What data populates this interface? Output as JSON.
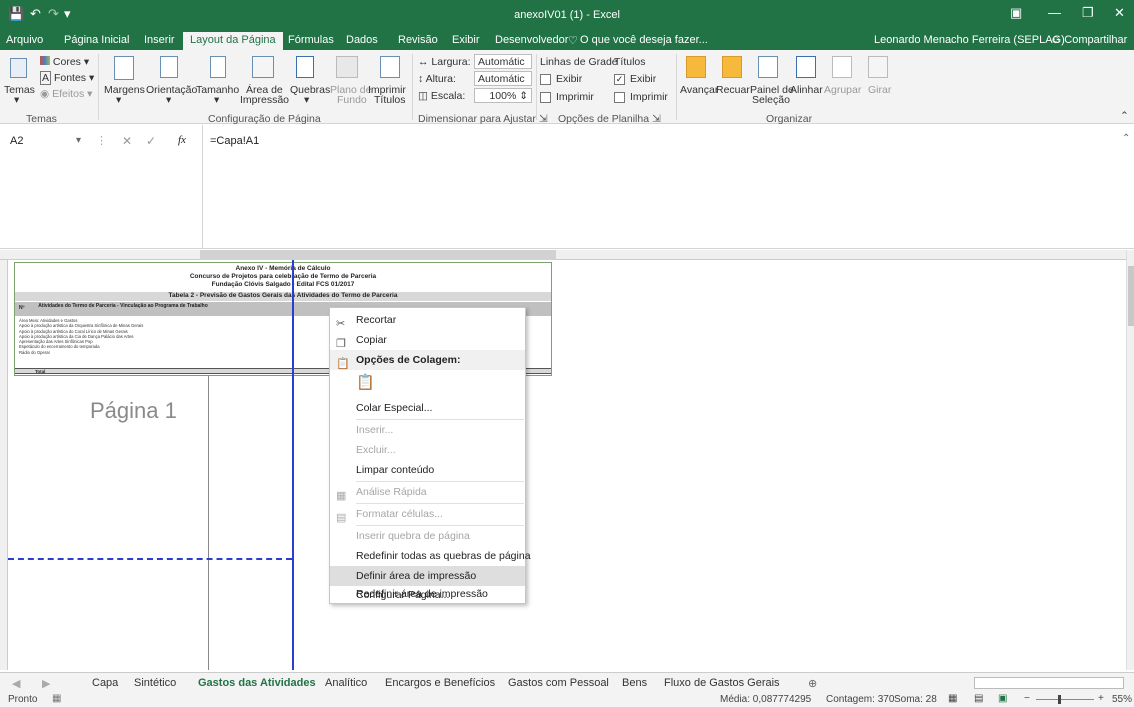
{
  "window": {
    "title": "anexoIV01 (1) - Excel",
    "user": "Leonardo Menacho Ferreira (SEPLAG)",
    "share": "Compartilhar"
  },
  "ribbon_tabs": [
    "Arquivo",
    "Página Inicial",
    "Inserir",
    "Layout da Página",
    "Fórmulas",
    "Dados",
    "Revisão",
    "Exibir",
    "Desenvolvedor"
  ],
  "tell_me": "O que você deseja fazer...",
  "ribbon": {
    "temas": "Temas",
    "cores": "Cores",
    "fontes": "Fontes",
    "efeitos": "Efeitos",
    "margens": "Margens",
    "orientacao": "Orientação",
    "tamanho": "Tamanho",
    "area_de": "Área de",
    "impressao": "Impressão",
    "quebras": "Quebras",
    "plano": "Plano de",
    "fundo": "Fundo",
    "imprimir": "Imprimir",
    "titulos": "Títulos",
    "largura_label": "Largura:",
    "largura_val": "Automátic",
    "altura_label": "Altura:",
    "altura_val": "Automátic",
    "escala_label": "Escala:",
    "escala_val": "100%",
    "linhas": "Linhas de Grade",
    "titulos2": "Títulos",
    "exibir": "Exibir",
    "imprimir2": "Imprimir",
    "avancar": "Avançar",
    "recuar": "Recuar",
    "painel": "Painel de",
    "selecao": "Seleção",
    "alinhar": "Alinhar",
    "agrupar": "Agrupar",
    "girar": "Girar",
    "g_temas": "Temas",
    "g_config": "Configuração de Página",
    "g_dimensionar": "Dimensionar para Ajustar",
    "g_opcoes": "Opções de Planilha",
    "g_organizar": "Organizar"
  },
  "formula": {
    "cell": "A2",
    "fx": "fx",
    "content": "=Capa!A1"
  },
  "sheet": {
    "title1": "Anexo IV - Memória de Cálculo",
    "title2": "Concurso de Projetos para celebração de Termo de Parceria",
    "title3": "Fundação Clóvis Salgado - Edital FCS 01/2017",
    "table_title": "Tabela 2 - Previsão de Gastos Gerais das Atividades do Termo de Parceria",
    "col_n": "Nº",
    "col_ativ": "Atividades do Termo de Parceria - Vinculação ao Programa de Trabalho",
    "rows": [
      "Área Meio: Atividades e Gastos",
      "Apoio à produção artística da Orquestra Sinfônica de Minas Gerais",
      "Apoio à produção artística do Coral Lírico de Minas Gerais",
      "Apoio à produção artística da Cia de Dança Palácio das Artes",
      "Apresentação das Artes Sinfônicas Pop",
      "Espetáculo do encerramento do temporada",
      "Rádio do Operar"
    ],
    "total": "Total",
    "page_label": "Página 1"
  },
  "context_menu": {
    "items": [
      "Recortar",
      "Copiar",
      "Opções de Colagem:",
      "",
      "Colar Especial...",
      "Inserir...",
      "Excluir...",
      "Limpar conteúdo",
      "Análise Rápida",
      "Formatar células...",
      "Inserir quebra de página",
      "Redefinir todas as quebras de página",
      "Definir área de impressão",
      "Redefinir área de impressão",
      "Configurar Página..."
    ]
  },
  "sheet_tabs": [
    "Capa",
    "Sintético",
    "Gastos das Atividades",
    "Analítico",
    "Encargos e Benefícios",
    "Gastos com Pessoal",
    "Bens",
    "Fluxo de Gastos Gerais"
  ],
  "status": {
    "ready": "Pronto",
    "media": "Média: 0,087774295",
    "contagem": "Contagem: 370",
    "soma": "Soma: 28",
    "zoom": "55%"
  }
}
